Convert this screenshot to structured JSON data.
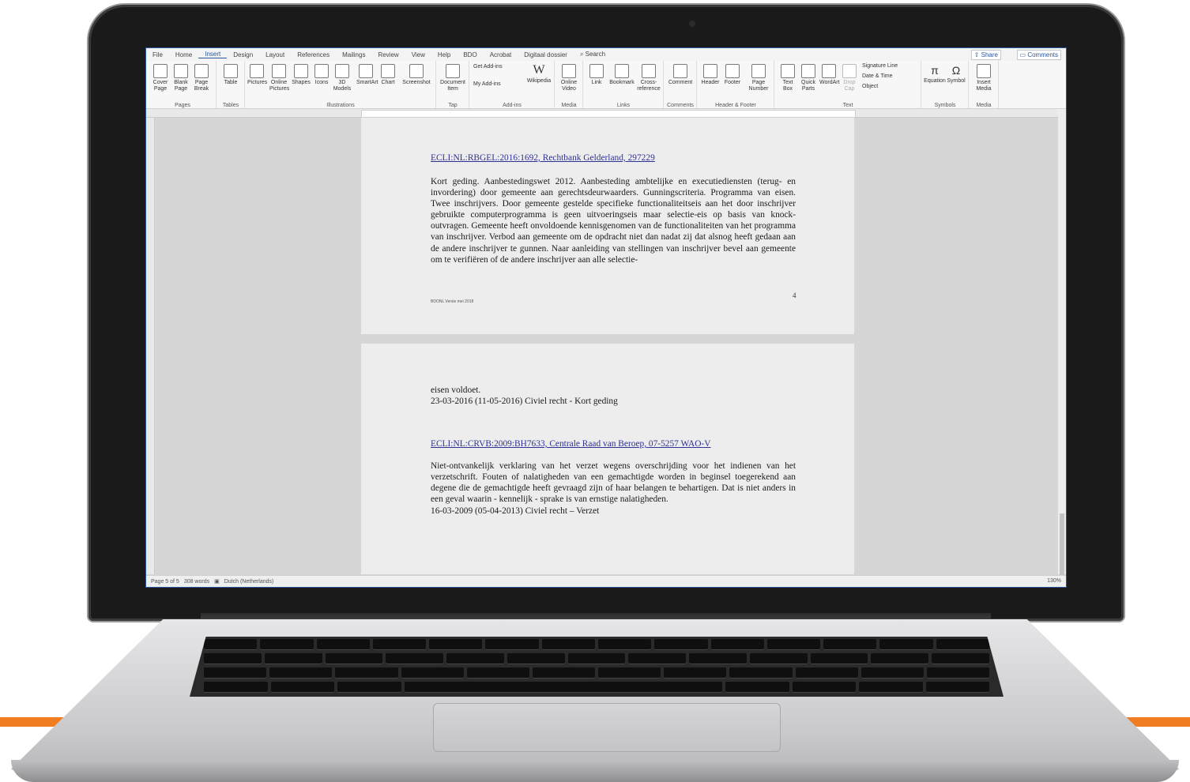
{
  "menu": {
    "tabs": [
      "File",
      "Home",
      "Insert",
      "Design",
      "Layout",
      "References",
      "Mailings",
      "Review",
      "View",
      "Help",
      "BDO",
      "Acrobat",
      "Digitaal dossier"
    ],
    "active": "Insert",
    "search_label": "Search",
    "share_label": "Share",
    "comments_label": "Comments"
  },
  "ribbon": {
    "groups": [
      {
        "label": "Pages",
        "buttons": [
          "Cover Page",
          "Blank Page",
          "Page Break"
        ]
      },
      {
        "label": "Tables",
        "buttons": [
          "Table"
        ]
      },
      {
        "label": "Illustrations",
        "buttons": [
          "Pictures",
          "Online Pictures",
          "Shapes",
          "Icons",
          "3D Models",
          "SmartArt",
          "Chart",
          "Screenshot"
        ]
      },
      {
        "label": "Tap",
        "buttons": [
          "Document Item"
        ]
      },
      {
        "label": "Add-ins",
        "buttons": [
          "Get Add-ins",
          "My Add-ins",
          "Wikipedia"
        ]
      },
      {
        "label": "Media",
        "buttons": [
          "Online Video"
        ]
      },
      {
        "label": "Links",
        "buttons": [
          "Link",
          "Bookmark",
          "Cross-reference"
        ]
      },
      {
        "label": "Comments",
        "buttons": [
          "Comment"
        ]
      },
      {
        "label": "Header & Footer",
        "buttons": [
          "Header",
          "Footer",
          "Page Number"
        ]
      },
      {
        "label": "Text",
        "buttons": [
          "Text Box",
          "Quick Parts",
          "WordArt",
          "Drop Cap",
          "Signature Line",
          "Date & Time",
          "Object"
        ]
      },
      {
        "label": "Symbols",
        "buttons": [
          "Equation",
          "Symbol"
        ]
      },
      {
        "label": "Media",
        "buttons": [
          "Insert Media"
        ]
      }
    ]
  },
  "document": {
    "page1": {
      "link": "ECLI:NL:RBGEL:2016:1692, Rechtbank Gelderland, 297229",
      "body": "Kort geding. Aanbestedingswet 2012. Aanbesteding ambtelijke en executiediensten (terug- en invordering) door gemeente aan gerechtsdeurwaarders. Gunningscriteria. Programma van eisen. Twee inschrijvers. Door gemeente gestelde specifieke functionaliteitseis aan het door inschrijver gebruikte computerprogramma is geen uitvoeringseis maar selectie-eis op basis van knock-outvragen. Gemeente heeft onvoldoende kennisgenomen van de functionaliteiten van het programma van inschrijver. Verbod aan gemeente om de opdracht niet dan nadat zij dat alsnog heeft gedaan aan de andere inschrijver te gunnen. Naar aanleiding van stellingen van inschrijver bevel aan gemeente om te verifiëren of de andere inschrijver aan alle selectie-",
      "footer": "BDONL Versie mei 2018",
      "page_number": "4"
    },
    "page2": {
      "line1": "eisen voldoet.",
      "line2": "23-03-2016 (11-05-2016) Civiel recht - Kort geding",
      "link": "ECLI:NL:CRVB:2009:BH7633, Centrale Raad van Beroep, 07-5257 WAO-V",
      "body": "Niet-ontvankelijk verklaring van het verzet wegens overschrijding voor het indienen van het verzetschrift. Fouten of nalatigheden van een gemachtigde worden in beginsel toegerekend aan degene die de gemachtigde heeft gevraagd zijn of haar belangen te behartigen. Dat is niet anders in een geval waarin - kennelijk - sprake is van ernstige nalatigheden.",
      "date_line": "16-03-2009 (05-04-2013) Civiel recht – Verzet"
    }
  },
  "status": {
    "page": "Page 5 of 5",
    "words": "308 words",
    "language": "Dutch (Netherlands)",
    "zoom": "130%"
  },
  "colors": {
    "accent": "#f07d22",
    "link": "#2e3192",
    "word_blue": "#2b579a"
  }
}
